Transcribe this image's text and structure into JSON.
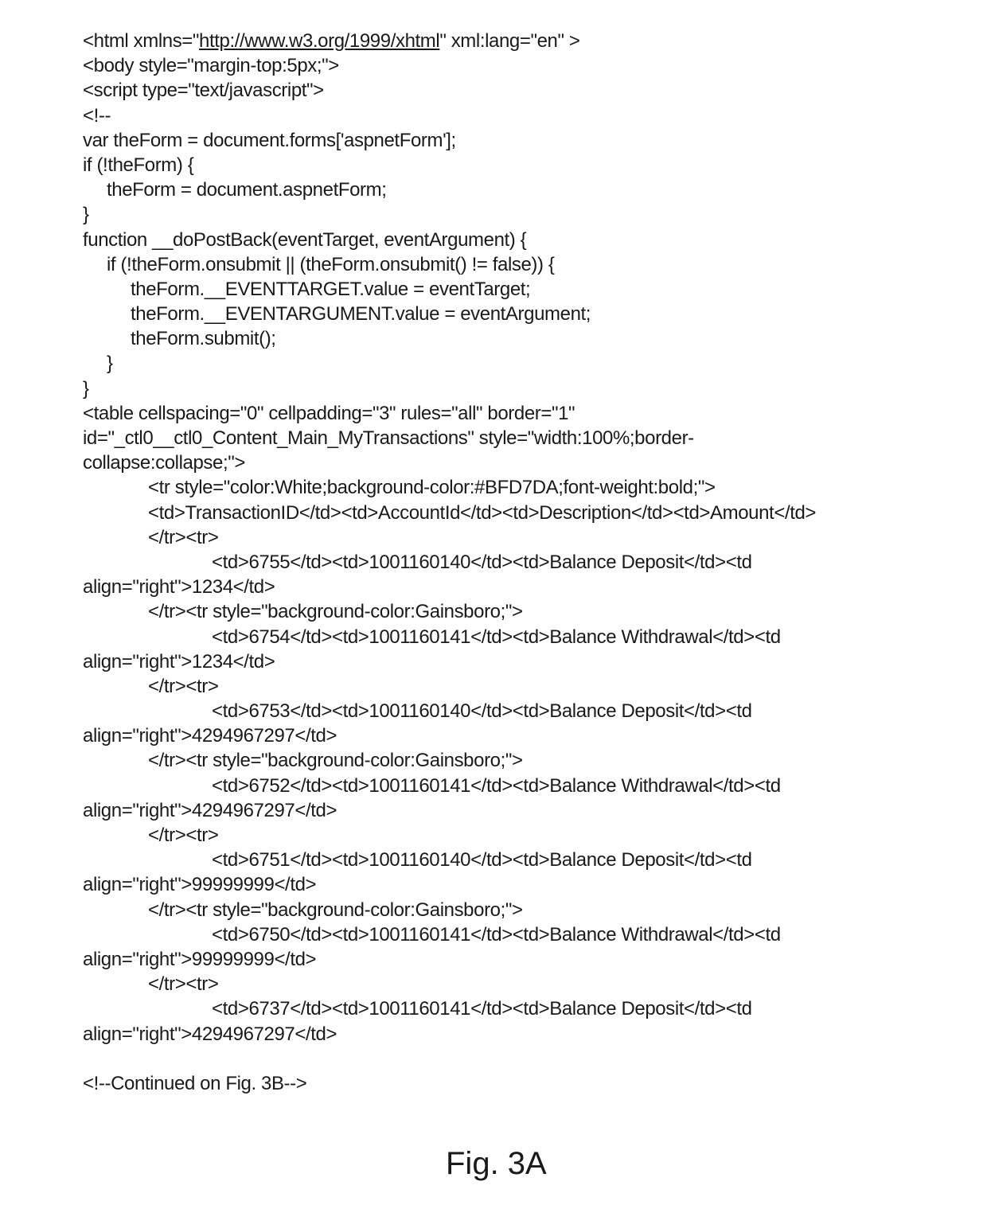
{
  "code": {
    "html_open_prefix": "<html xmlns=\"",
    "html_namespace_link": "http://www.w3.org/1999/xhtml",
    "html_open_suffix": "\" xml:lang=\"en\" >",
    "lines": [
      "<body style=\"margin-top:5px;\">",
      "<script type=\"text/javascript\">",
      "<!--",
      "var theForm = document.forms['aspnetForm'];",
      "if (!theForm) {",
      "theForm = document.aspnetForm;",
      "}",
      "function __doPostBack(eventTarget, eventArgument) {",
      "if (!theForm.onsubmit || (theForm.onsubmit() != false)) {",
      "theForm.__EVENTTARGET.value = eventTarget;",
      "theForm.__EVENTARGUMENT.value = eventArgument;",
      "theForm.submit();",
      "}",
      "}",
      "<table cellspacing=\"0\" cellpadding=\"3\" rules=\"all\" border=\"1\"",
      "id=\"_ctl0__ctl0_Content_Main_MyTransactions\" style=\"width:100%;border-",
      "collapse:collapse;\">",
      "<tr style=\"color:White;background-color:#BFD7DA;font-weight:bold;\">",
      "<td>TransactionID</td><td>AccountId</td><td>Description</td><td>Amount</td>",
      "</tr><tr>",
      "<td>6755</td><td>1001160140</td><td>Balance Deposit</td><td",
      "align=\"right\">1234</td>",
      "</tr><tr style=\"background-color:Gainsboro;\">",
      "<td>6754</td><td>1001160141</td><td>Balance Withdrawal</td><td",
      "align=\"right\">1234</td>",
      "</tr><tr>",
      "<td>6753</td><td>1001160140</td><td>Balance Deposit</td><td",
      "align=\"right\">4294967297</td>",
      "</tr><tr style=\"background-color:Gainsboro;\">",
      "<td>6752</td><td>1001160141</td><td>Balance Withdrawal</td><td",
      "align=\"right\">4294967297</td>",
      "</tr><tr>",
      "<td>6751</td><td>1001160140</td><td>Balance Deposit</td><td",
      "align=\"right\">99999999</td>",
      "</tr><tr style=\"background-color:Gainsboro;\">",
      "<td>6750</td><td>1001160141</td><td>Balance Withdrawal</td><td",
      "align=\"right\">99999999</td>",
      "</tr><tr>",
      "<td>6737</td><td>1001160141</td><td>Balance Deposit</td><td",
      "align=\"right\">4294967297</td>",
      "",
      "<!--Continued on Fig. 3B-->"
    ]
  },
  "figure_label": "Fig. 3A"
}
